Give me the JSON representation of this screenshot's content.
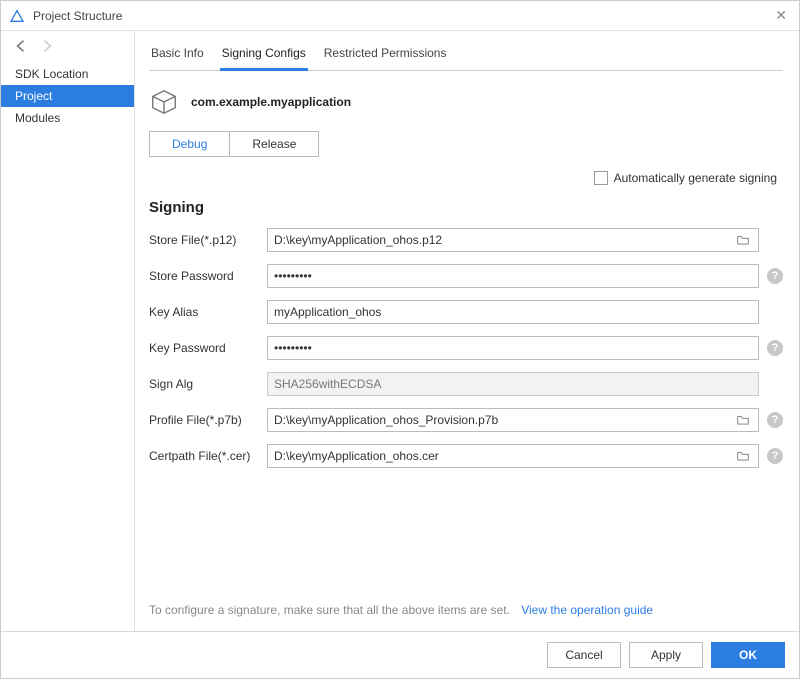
{
  "window": {
    "title": "Project Structure"
  },
  "sidebar": {
    "items": [
      {
        "label": "SDK Location",
        "selected": false
      },
      {
        "label": "Project",
        "selected": true
      },
      {
        "label": "Modules",
        "selected": false
      }
    ]
  },
  "tabs": [
    {
      "label": "Basic Info",
      "active": false
    },
    {
      "label": "Signing Configs",
      "active": true
    },
    {
      "label": "Restricted Permissions",
      "active": false
    }
  ],
  "app": {
    "name": "com.example.myapplication"
  },
  "buildTypes": [
    {
      "label": "Debug",
      "active": true
    },
    {
      "label": "Release",
      "active": false
    }
  ],
  "autoSign": {
    "label": "Automatically generate signing",
    "checked": false
  },
  "signing": {
    "title": "Signing",
    "storeFile": {
      "label": "Store File(*.p12)",
      "value": "D:\\key\\myApplication_ohos.p12"
    },
    "storePassword": {
      "label": "Store Password",
      "value": "•••••••••"
    },
    "keyAlias": {
      "label": "Key Alias",
      "value": "myApplication_ohos"
    },
    "keyPassword": {
      "label": "Key Password",
      "value": "•••••••••"
    },
    "signAlg": {
      "label": "Sign Alg",
      "value": "SHA256withECDSA"
    },
    "profileFile": {
      "label": "Profile File(*.p7b)",
      "value": "D:\\key\\myApplication_ohos_Provision.p7b"
    },
    "certpathFile": {
      "label": "Certpath File(*.cer)",
      "value": "D:\\key\\myApplication_ohos.cer"
    }
  },
  "hint": {
    "text": "To configure a signature, make sure that all the above items are set.",
    "link": "View the operation guide"
  },
  "footer": {
    "cancel": "Cancel",
    "apply": "Apply",
    "ok": "OK"
  }
}
